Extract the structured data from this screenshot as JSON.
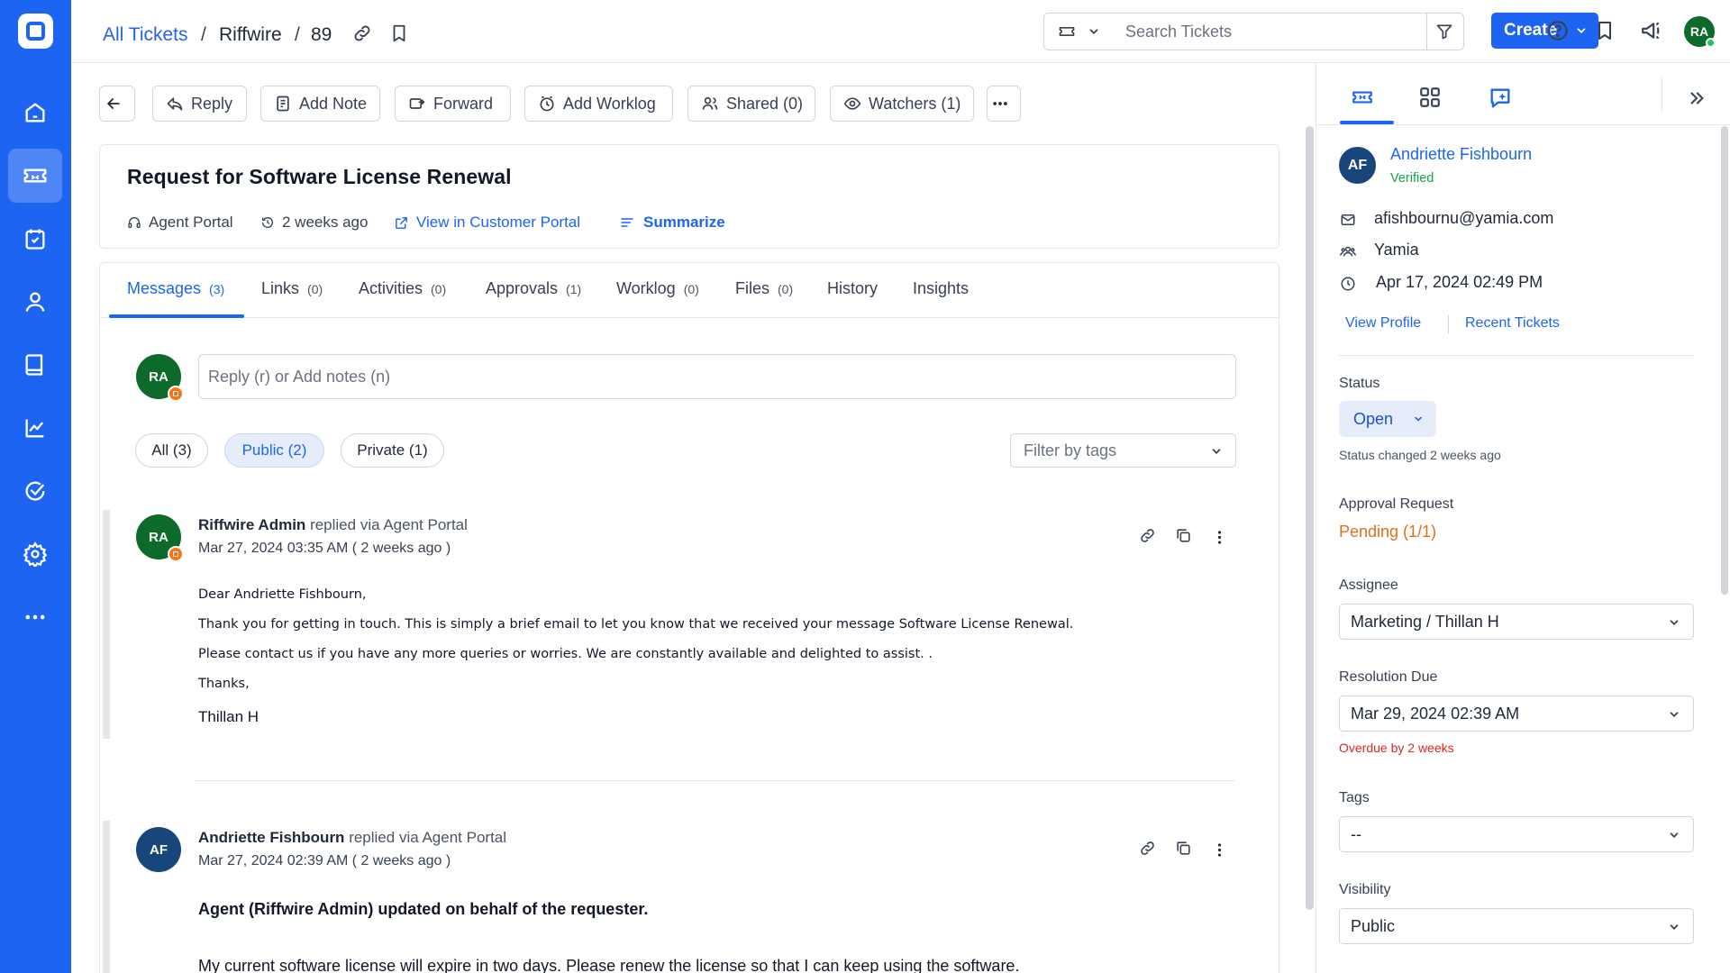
{
  "header": {
    "breadcrumb": {
      "root": "All Tickets",
      "sep": "/",
      "org": "Riffwire",
      "ticket_id": "89"
    },
    "search": {
      "placeholder": "Search Tickets"
    },
    "create_label": "Create",
    "user_initials": "RA"
  },
  "nav": {
    "items": [
      "home-icon",
      "tickets-icon",
      "tasks-icon",
      "contacts-icon",
      "knowledge-base-icon",
      "reports-icon",
      "approvals-icon",
      "settings-icon",
      "more-icon"
    ]
  },
  "toolbar": {
    "reply": "Reply",
    "add_note": "Add Note",
    "forward": "Forward",
    "add_worklog": "Add Worklog",
    "shared": "Shared (0)",
    "watchers": "Watchers (1)"
  },
  "ticket": {
    "title": "Request for Software License Renewal",
    "source": "Agent Portal",
    "age": "2 weeks ago",
    "customer_portal_link": "View in Customer Portal",
    "summarize": "Summarize"
  },
  "tabs": [
    {
      "label": "Messages",
      "count": "(3)"
    },
    {
      "label": "Links",
      "count": "(0)"
    },
    {
      "label": "Activities",
      "count": "(0)"
    },
    {
      "label": "Approvals",
      "count": "(1)"
    },
    {
      "label": "Worklog",
      "count": "(0)"
    },
    {
      "label": "Files",
      "count": "(0)"
    },
    {
      "label": "History",
      "count": ""
    },
    {
      "label": "Insights",
      "count": ""
    }
  ],
  "composer": {
    "initials": "RA",
    "placeholder": "Reply (r) or Add notes (n)"
  },
  "filters": {
    "all": "All (3)",
    "public": "Public (2)",
    "private": "Private (1)",
    "tags_placeholder": "Filter by tags"
  },
  "messages": [
    {
      "initials": "RA",
      "author": "Riffwire Admin",
      "via": "replied via Agent Portal",
      "timestamp": "Mar 27, 2024 03:35 AM ( 2 weeks ago )",
      "lines": [
        "Dear Andriette Fishbourn,",
        "Thank you for getting in touch. This is simply a brief email to let you know that we received your message Software License Renewal.",
        "Please contact us if you have any more queries or worries. We are constantly available and delighted to assist. .",
        "Thanks,"
      ],
      "signature": "Thillan H"
    },
    {
      "initials": "AF",
      "author": "Andriette Fishbourn",
      "via": "replied via Agent Portal",
      "timestamp": "Mar 27, 2024 02:39 AM ( 2 weeks ago )",
      "headline": "Agent (Riffwire Admin) updated on behalf of the requester.",
      "body": "My current software license will expire in two days. Please renew the license so that I can keep using the software."
    }
  ],
  "requester": {
    "initials": "AF",
    "name": "Andriette Fishbourn",
    "verified": "Verified",
    "email": "afishbournu@yamia.com",
    "company": "Yamia",
    "created": "Apr 17, 2024 02:49 PM",
    "view_profile": "View Profile",
    "recent_tickets": "Recent Tickets"
  },
  "properties": {
    "status_label": "Status",
    "status_value": "Open",
    "status_changed": "Status changed 2 weeks ago",
    "approval_label": "Approval Request",
    "approval_value": "Pending (1/1)",
    "assignee_label": "Assignee",
    "assignee_value": "Marketing / Thillan H",
    "resolution_label": "Resolution Due",
    "resolution_value": "Mar 29, 2024 02:39 AM",
    "overdue_text": "Overdue by 2 weeks",
    "tags_label": "Tags",
    "tags_value": "--",
    "visibility_label": "Visibility",
    "visibility_value": "Public"
  },
  "colors": {
    "accent": "#1d64f2",
    "avatar_green": "#0e6a2b",
    "avatar_blue": "#19467a",
    "pending_orange": "#e0701b",
    "overdue_red": "#dc2626",
    "verified_green": "#16a34a"
  }
}
